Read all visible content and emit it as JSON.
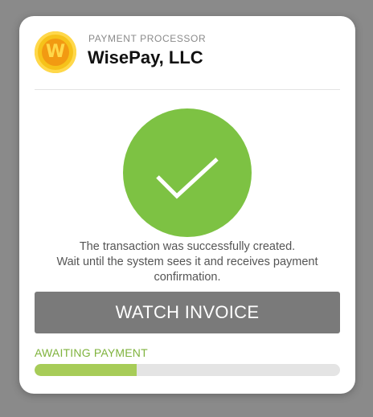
{
  "header": {
    "kicker": "PAYMENT PROCESSOR",
    "provider_name": "WisePay, LLC",
    "logo_letter": "W"
  },
  "success_icon": "checkmark-icon",
  "message": {
    "line1": "The transaction was successfully created.",
    "line2": "Wait until the system sees it and receives payment",
    "line3": "confirmation."
  },
  "watch_button_label": "WATCH INVOICE",
  "status": {
    "label": "AWAITING PAYMENT",
    "progress_fraction": 0.335
  },
  "colors": {
    "success_green": "#7dc243",
    "status_green": "#7fb33d",
    "progress_fill": "#a7cc58",
    "button_gray": "#7a7a7a",
    "logo_gold": "#f6c21a"
  }
}
